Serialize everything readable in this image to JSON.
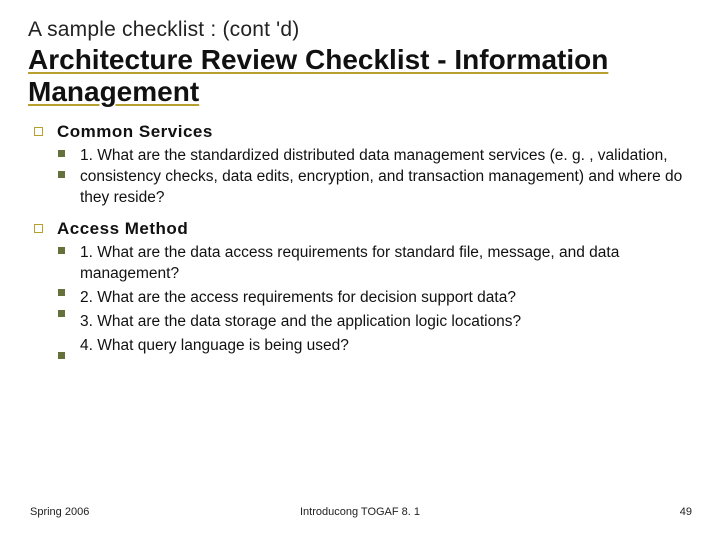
{
  "supertitle": "A sample checklist : (cont 'd)",
  "title": "Architecture Review Checklist - Information Management",
  "sections": [
    {
      "heading": "Common Services",
      "bullet_tops": [
        4,
        25
      ],
      "items": [
        "1. What are the standardized distributed data management services (e. g. , validation, consistency checks, data edits, encryption, and transaction management) and where do they reside?"
      ]
    },
    {
      "heading": "Access Method",
      "bullet_tops": [
        4,
        46,
        67,
        109
      ],
      "items": [
        "1. What are the data access requirements for standard file, message, and data management?",
        "2. What are the access requirements for decision support data?",
        "3. What are the data storage and the application logic locations?",
        "4. What query language is being used?"
      ]
    }
  ],
  "footer": {
    "left": "Spring 2006",
    "center": "Introducong TOGAF 8. 1",
    "right": "49"
  }
}
